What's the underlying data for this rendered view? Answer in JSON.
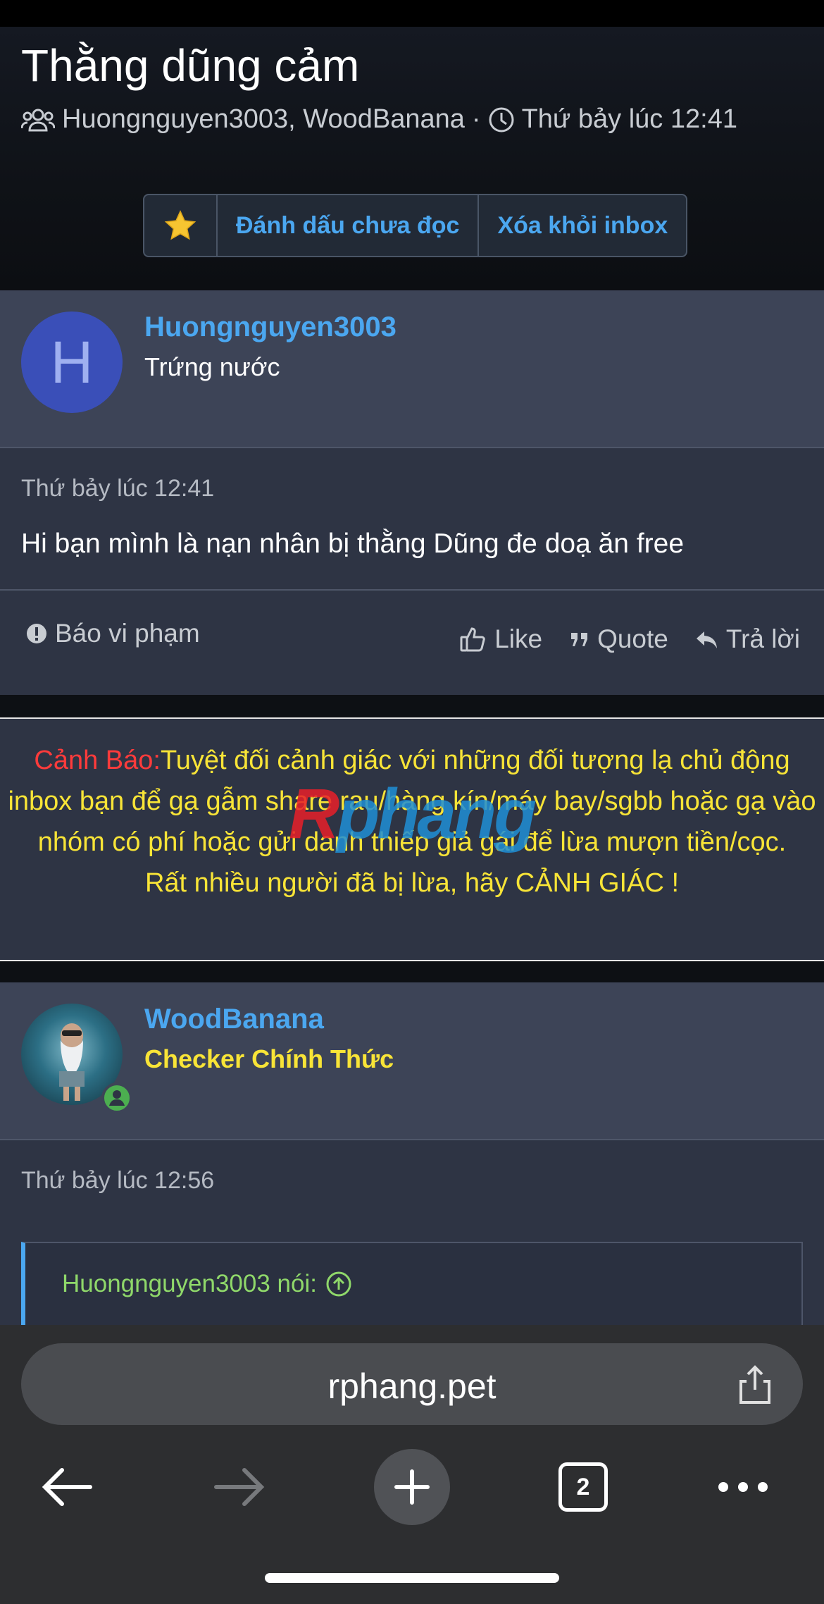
{
  "thread": {
    "title": "Thằng dũng cảm",
    "participants": "Huongnguyen3003, WoodBanana",
    "separator": "·",
    "time": "Thứ bảy lúc 12:41",
    "actions": {
      "star_icon": "star-icon",
      "mark_unread": "Đánh dấu chưa đọc",
      "remove_inbox": "Xóa khỏi inbox"
    }
  },
  "post1": {
    "avatar_letter": "H",
    "username": "Huongnguyen3003",
    "role": "Trứng nước",
    "time": "Thứ bảy lúc 12:41",
    "text": "Hi bạn mình là nạn nhân bị thằng Dũng đe doạ ăn free",
    "report": "Báo vi phạm",
    "like": "Like",
    "quote": "Quote",
    "reply": "Trả lời"
  },
  "warning": {
    "label": "Cảnh Báo:",
    "body": "Tuyệt đối cảnh giác với những đối tượng lạ chủ động inbox bạn để gạ gẫm share rau/hàng kín/máy bay/sgbb hoặc gạ vào nhóm có phí hoặc gửi danh thiếp giả gái để lừa mượn tiền/cọc.",
    "footer": "Rất nhiều người đã bị lừa, hãy CẢNH GIÁC !",
    "watermark_r": "R",
    "watermark_rest": "phang"
  },
  "post2": {
    "username": "WoodBanana",
    "role": "Checker Chính Thức",
    "time": "Thứ bảy lúc 12:56",
    "quote_author": "Huongnguyen3003 nói:"
  },
  "browser": {
    "url": "rphang.pet",
    "tab_count": "2"
  },
  "colors": {
    "accent": "#4ba7f0",
    "warning_yellow": "#f8e437",
    "warning_red": "#ff3b3b",
    "quote_green": "#8fd86a",
    "online_green": "#4caf50"
  }
}
